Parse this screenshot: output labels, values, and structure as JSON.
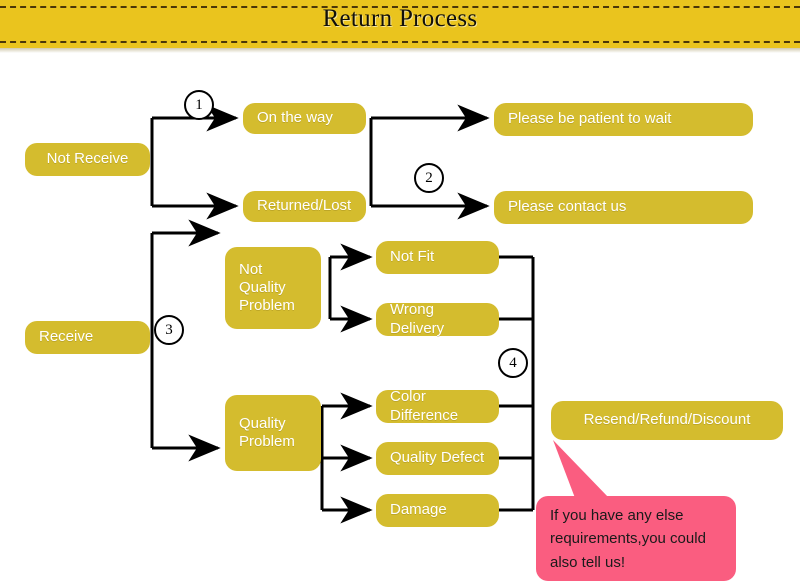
{
  "banner": {
    "title": "Return Process",
    "background_color": "#eac41e",
    "dash_color": "#4a3608"
  },
  "theme": {
    "node_color": "#d4bc2e",
    "node_text_color": "#ffffff",
    "line_color": "#000000",
    "callout_color": "#fa5d80",
    "page_background": "#ffffff"
  },
  "flow": {
    "nodes": [
      {
        "id": "not-receive",
        "label": "Not Receive"
      },
      {
        "id": "on-the-way",
        "label": "On the way"
      },
      {
        "id": "returned-lost",
        "label": "Returned/Lost"
      },
      {
        "id": "please-wait",
        "label": "Please be patient to wait"
      },
      {
        "id": "please-contact",
        "label": "Please contact us"
      },
      {
        "id": "receive",
        "label": "Receive"
      },
      {
        "id": "not-quality",
        "label": "Not\nQuality\nProblem"
      },
      {
        "id": "quality-problem",
        "label": "Quality\nProblem"
      },
      {
        "id": "not-fit",
        "label": "Not Fit"
      },
      {
        "id": "wrong-delivery",
        "label": "Wrong Delivery"
      },
      {
        "id": "color-difference",
        "label": "Color Difference"
      },
      {
        "id": "quality-defect",
        "label": "Quality Defect"
      },
      {
        "id": "damage",
        "label": "Damage"
      },
      {
        "id": "resolution",
        "label": "Resend/Refund/Discount"
      }
    ],
    "steps": [
      {
        "id": "step-1",
        "label": "1"
      },
      {
        "id": "step-2",
        "label": "2"
      },
      {
        "id": "step-3",
        "label": "3"
      },
      {
        "id": "step-4",
        "label": "4"
      }
    ]
  },
  "callout": {
    "text": "If you have any else requirements,you could also tell us!"
  }
}
